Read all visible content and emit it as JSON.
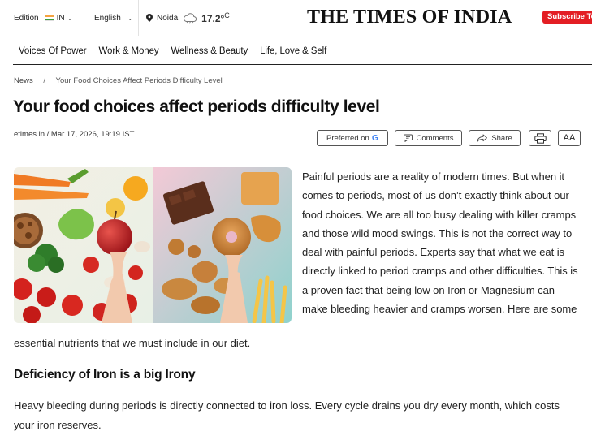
{
  "topbar": {
    "edition_label": "Edition",
    "edition_value": "IN",
    "language": "English",
    "city": "Noida",
    "temperature": "17.2°",
    "temperature_unit": "C",
    "logo": "THE TIMES OF INDIA",
    "subscribe_label": "Subscribe To"
  },
  "nav": {
    "items": [
      "Voices Of Power",
      "Work & Money",
      "Wellness & Beauty",
      "Life, Love & Self"
    ]
  },
  "breadcrumb": {
    "section": "News",
    "separator": "/",
    "current": "Your Food Choices Affect Periods Difficulty Level"
  },
  "article": {
    "title": "Your food choices affect periods difficulty level",
    "byline": "etimes.in / Mar 17, 2026, 19:19 IST",
    "actions": {
      "preferred_label": "Preferred on",
      "preferred_brand": "G",
      "comments_label": "Comments",
      "share_label": "Share",
      "font_size_label": "AA"
    },
    "lead": "Painful periods are a reality of modern times. But when it comes to periods, most of us don’t exactly think about our food choices. We are all too busy dealing with killer cramps and those wild mood swings. This is not the correct way to deal with painful periods. Experts say that what we eat is directly linked to period cramps and other difficulties. This is a proven fact that being low on Iron or Magnesium can make bleeding heavier and cramps worsen. Here are some",
    "lead_tail": "essential nutrients that we must include in our diet.",
    "subheading": "Deficiency of Iron is a big Irony",
    "paragraph": "Heavy bleeding during periods is directly connected to iron loss. Every cycle drains you dry every month, which costs your iron reserves."
  },
  "colors": {
    "subscribe_bg": "#e31e24",
    "google_blue": "#4285f4",
    "nav_rule": "#222222"
  }
}
